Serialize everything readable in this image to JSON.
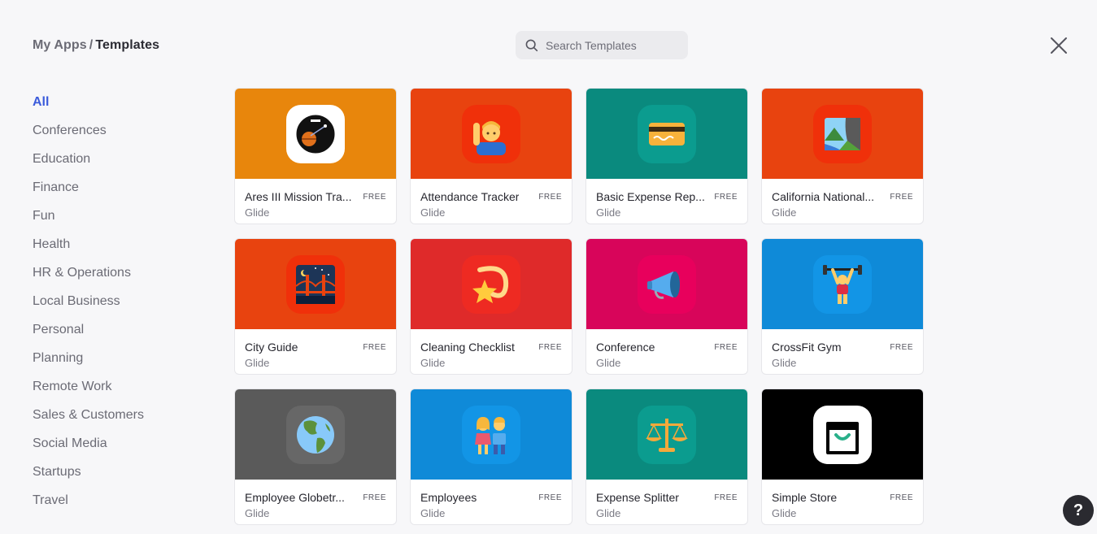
{
  "breadcrumb": {
    "parent": "My Apps",
    "separator": "/",
    "current": "Templates"
  },
  "search": {
    "placeholder": "Search Templates",
    "value": ""
  },
  "categories": [
    "All",
    "Conferences",
    "Education",
    "Finance",
    "Fun",
    "Health",
    "HR & Operations",
    "Local Business",
    "Personal",
    "Planning",
    "Remote Work",
    "Sales & Customers",
    "Social Media",
    "Startups",
    "Travel"
  ],
  "selected_category": "All",
  "templates": [
    {
      "title": "Ares III Mission Tra...",
      "author": "Glide",
      "badge": "FREE",
      "bg": "#e8860c",
      "icon_bg": "#ffffff",
      "icon": "ares-mission-patch-icon"
    },
    {
      "title": "Attendance Tracker",
      "author": "Glide",
      "badge": "FREE",
      "bg": "#e8430f",
      "icon_bg": "#f0300a",
      "icon": "raised-hand-person-icon"
    },
    {
      "title": "Basic Expense Rep...",
      "author": "Glide",
      "badge": "FREE",
      "bg": "#0a8a7e",
      "icon_bg": "#0b9c8f",
      "icon": "credit-card-icon"
    },
    {
      "title": "California National...",
      "author": "Glide",
      "badge": "FREE",
      "bg": "#e8430f",
      "icon_bg": "#f0300a",
      "icon": "national-park-icon"
    },
    {
      "title": "City Guide",
      "author": "Glide",
      "badge": "FREE",
      "bg": "#e8430f",
      "icon_bg": "#f0300a",
      "icon": "bridge-at-night-icon"
    },
    {
      "title": "Cleaning Checklist",
      "author": "Glide",
      "badge": "FREE",
      "bg": "#df2a2a",
      "icon_bg": "#ee2a22",
      "icon": "shooting-star-icon"
    },
    {
      "title": "Conference",
      "author": "Glide",
      "badge": "FREE",
      "bg": "#d8055a",
      "icon_bg": "#e8005c",
      "icon": "megaphone-icon"
    },
    {
      "title": "CrossFit Gym",
      "author": "Glide",
      "badge": "FREE",
      "bg": "#0f8ad8",
      "icon_bg": "#1295e6",
      "icon": "weightlifter-icon"
    },
    {
      "title": "Employee Globetr...",
      "author": "Glide",
      "badge": "FREE",
      "bg": "#5a5a5a",
      "icon_bg": "#676767",
      "icon": "globe-americas-icon"
    },
    {
      "title": "Employees",
      "author": "Glide",
      "badge": "FREE",
      "bg": "#0f8ad8",
      "icon_bg": "#1295e6",
      "icon": "two-people-icon"
    },
    {
      "title": "Expense Splitter",
      "author": "Glide",
      "badge": "FREE",
      "bg": "#0a8a7e",
      "icon_bg": "#0b9c8f",
      "icon": "balance-scale-icon"
    },
    {
      "title": "Simple Store",
      "author": "Glide",
      "badge": "FREE",
      "bg": "#000000",
      "icon_bg": "#ffffff",
      "icon": "shopping-bag-icon"
    }
  ],
  "help": {
    "label": "?"
  },
  "colors": {
    "accent": "#3b5bdb",
    "background": "#f7f7f9"
  }
}
